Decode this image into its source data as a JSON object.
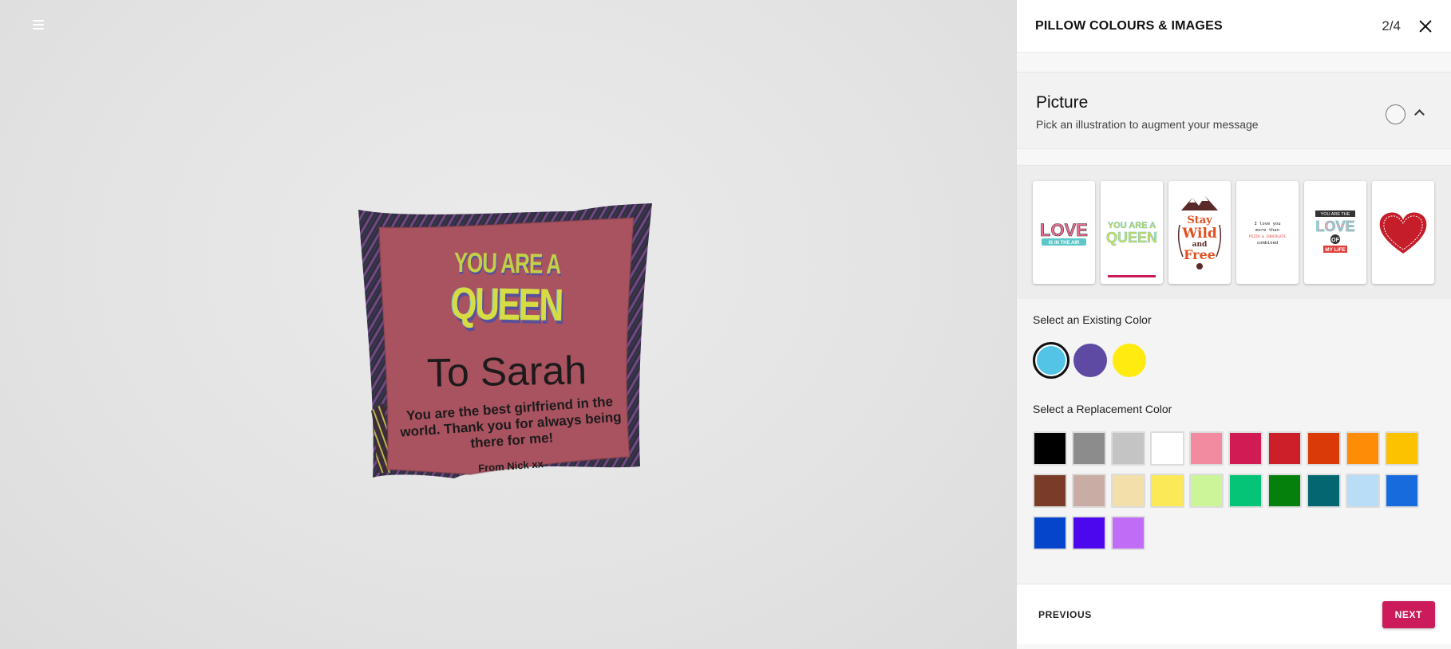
{
  "header": {
    "title": "PILLOW COLOURS & IMAGES",
    "step": "2/4"
  },
  "icons": {
    "menu": "hamburger-menu-icon",
    "close": "close-icon",
    "collapse": "chevron-up-icon"
  },
  "pillow": {
    "art_line1": "YOU ARE A",
    "art_line2": "QUEEN",
    "title": "To Sarah",
    "message": "You are the best girlfriend in the world. Thank you for always being there for me!",
    "from": "From Nick xx",
    "fabric_color": "#a8535f"
  },
  "section": {
    "name": "Picture",
    "subtitle": "Pick an illustration to augment your message"
  },
  "thumbnails": [
    {
      "name": "love-is-in-the-air",
      "line1": "LOVE",
      "line2": "IS IN THE AIR"
    },
    {
      "name": "you-are-a-queen",
      "line1": "YOU ARE A",
      "line2": "QUEEN",
      "selected": true
    },
    {
      "name": "stay-wild-and-free",
      "line1": "Stay",
      "line2": "Wild",
      "line3": "and",
      "line4": "Free"
    },
    {
      "name": "i-love-you-more-than-pizza",
      "line1": "I love you",
      "line2": "more than",
      "line3": "PIZZA & CHOCOLATE",
      "line4": "combined"
    },
    {
      "name": "you-are-the-love-of-my-life",
      "line1": "YOU ARE THE",
      "line2": "LOVE",
      "line3": "OF",
      "line4": "MY LIFE"
    },
    {
      "name": "heart"
    }
  ],
  "existing_colors": {
    "label": "Select an Existing Color",
    "colors": [
      "#53c3e6",
      "#5e4aa3",
      "#ffeb0f"
    ]
  },
  "replacement_colors": {
    "label": "Select a Replacement Color",
    "colors": [
      "#000000",
      "#8c8c8c",
      "#c4c4c4",
      "#ffffff",
      "#f28aa0",
      "#d11b55",
      "#cc1f2a",
      "#d93a07",
      "#ff8c07",
      "#fcc200",
      "#7a3b28",
      "#c9ada5",
      "#f3dfaa",
      "#fbe957",
      "#ccf59a",
      "#05c477",
      "#05800c",
      "#036670",
      "#b9dcf7",
      "#176bdd",
      "#0545cc",
      "#4c07ee",
      "#c16cf7"
    ]
  },
  "footer": {
    "previous": "PREVIOUS",
    "next": "NEXT"
  },
  "accent": "#cc1b5a"
}
